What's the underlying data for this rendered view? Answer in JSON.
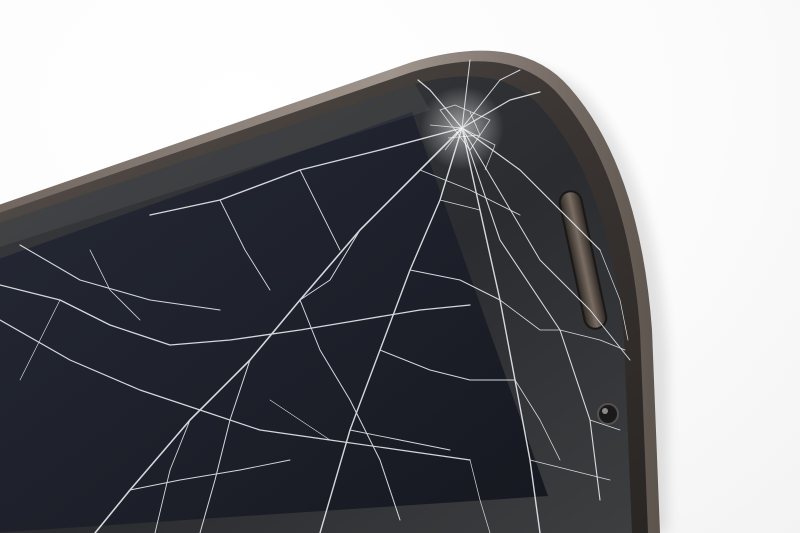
{
  "scene": {
    "subject": "cracked-smartphone",
    "colors": {
      "background": "#ffffff",
      "phone_body": "#3a3533",
      "bezel_rim": "#8a7f78",
      "glass": "#2a2c30",
      "display_panel": "#1c1e26",
      "crack_lines": "#e8ecef"
    }
  }
}
